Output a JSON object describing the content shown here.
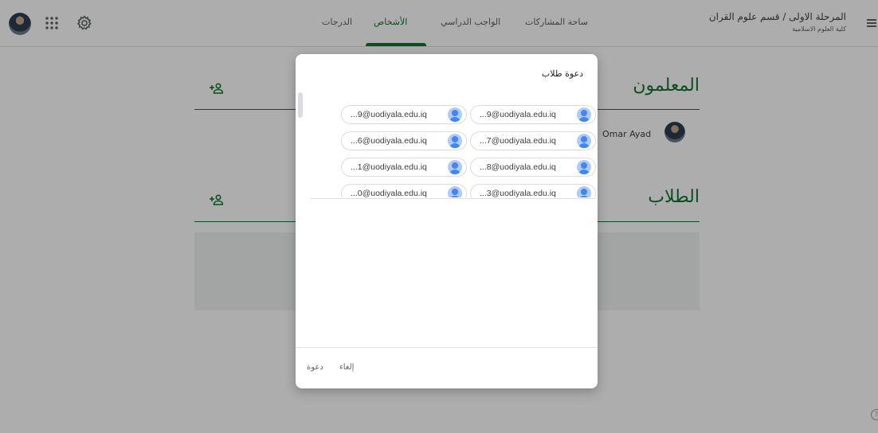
{
  "topbar": {
    "class_title_line": "المرحلة الاولى / قسم علوم القران",
    "class_subtitle": "كلية العلوم الاسلامية",
    "tabs": [
      {
        "label": "ساحة المشاركات",
        "active": false
      },
      {
        "label": "الواجب الدراسي",
        "active": false
      },
      {
        "label": "الأشخاص",
        "active": true
      },
      {
        "label": "الدرجات",
        "active": false
      }
    ]
  },
  "people": {
    "teachers_heading": "المعلمون",
    "teacher_name": "Omar Ayad",
    "students_heading": "الطلاب"
  },
  "dialog": {
    "title": "دعوة طلاب",
    "invitees": [
      "...9@uodiyala.edu.iq",
      "...9@uodiyala.edu.iq",
      "...7@uodiyala.edu.iq",
      "...6@uodiyala.edu.iq",
      "...8@uodiyala.edu.iq",
      "...1@uodiyala.edu.iq",
      "...3@uodiyala.edu.iq",
      "...0@uodiyala.edu.iq"
    ],
    "cancel_label": "إلغاء",
    "invite_label": "دعوة"
  },
  "colors": {
    "accent": "#137333",
    "chip_avatar": "#4285f4",
    "scrim": "rgba(0,0,0,0.32)"
  },
  "icons": [
    "menu-icon",
    "apps-icon",
    "gear-icon",
    "add-person-icon",
    "user-placeholder-icon",
    "help-icon"
  ]
}
